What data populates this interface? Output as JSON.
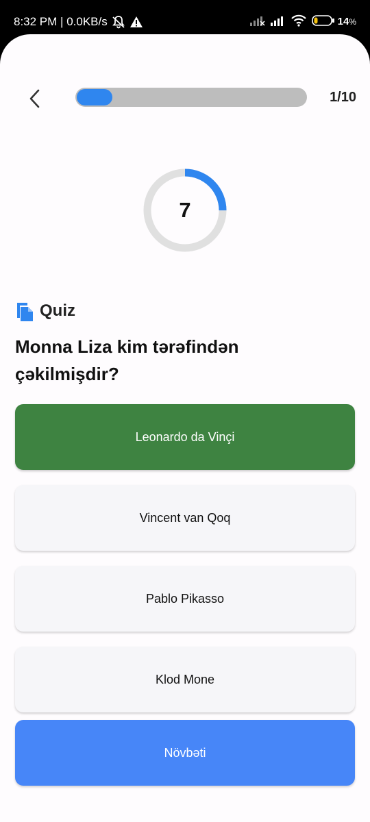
{
  "status_bar": {
    "time": "8:32 PM",
    "network_speed": "0.0KB/s",
    "battery": "14",
    "battery_unit": "%",
    "icons": [
      "muted-bell-icon",
      "alert-icon",
      "signal-off-icon",
      "signal-icon",
      "wifi-icon",
      "battery-icon"
    ]
  },
  "header": {
    "progress_count": "1/10",
    "progress_fraction": 0.1,
    "accent_color": "#2f86ef"
  },
  "timer": {
    "value": "7",
    "remaining_fraction": 0.25
  },
  "quiz": {
    "label": "Quiz",
    "icon": "document-icon",
    "question": "Monna Liza kim tərəfindən çəkilmişdir?"
  },
  "answers": [
    {
      "label": "Leonardo da Vinçi",
      "state": "correct"
    },
    {
      "label": "Vincent van Qoq",
      "state": "neutral"
    },
    {
      "label": "Pablo Pikasso",
      "state": "neutral"
    },
    {
      "label": "Klod Mone",
      "state": "neutral"
    }
  ],
  "next_button": {
    "label": "Növbəti"
  },
  "colors": {
    "correct": "#3e8341",
    "primary": "#4786f8",
    "option_bg": "#f6f6f9"
  }
}
